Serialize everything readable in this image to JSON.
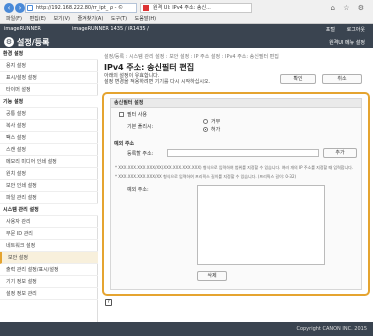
{
  "browser": {
    "address": "http://192.168.222.80/rr_ipt_ ρ - ©",
    "tab_title": "원격 UI: IPv4 주소: 송신...",
    "menu": [
      "파일(F)",
      "편집(E)",
      "보기(V)",
      "즐겨찾기(A)",
      "도구(T)",
      "도움말(H)"
    ]
  },
  "header": {
    "brand": "imageRUNNER",
    "model": "imageRUNNER 1435 / iR1435 /",
    "portal_link": "포털",
    "logout_link": "로그아웃",
    "section_title": "설정/등록",
    "user_info": "원격UI 메뉴 설정"
  },
  "sidebar": {
    "items": [
      {
        "label": "환경 설정",
        "type": "head"
      },
      {
        "label": "용지 설정",
        "type": "item"
      },
      {
        "label": "표시/설정 설정",
        "type": "item"
      },
      {
        "label": "타이머 설정",
        "type": "item"
      },
      {
        "label": "기능 설정",
        "type": "head"
      },
      {
        "label": "공통 설정",
        "type": "item"
      },
      {
        "label": "복사 설정",
        "type": "item"
      },
      {
        "label": "팩스 설정",
        "type": "item"
      },
      {
        "label": "스캔 설정",
        "type": "item"
      },
      {
        "label": "메모리 미디어 인쇄 설정",
        "type": "item"
      },
      {
        "label": "원치 설정",
        "type": "item"
      },
      {
        "label": "보안 인쇄 설정",
        "type": "item"
      },
      {
        "label": "파일 관리 설정",
        "type": "item"
      },
      {
        "label": "시스템 관리 설정",
        "type": "head"
      },
      {
        "label": "사용자 관리",
        "type": "item"
      },
      {
        "label": "부문 ID 관리",
        "type": "item"
      },
      {
        "label": "네트워크 설정",
        "type": "item"
      },
      {
        "label": "보안 설정",
        "type": "active"
      },
      {
        "label": "출력 관리 설정/표시/설정",
        "type": "item"
      },
      {
        "label": "기기 정보 설정",
        "type": "item"
      },
      {
        "label": "설정 정보 관리",
        "type": "item"
      }
    ]
  },
  "main": {
    "breadcrumb": "설정/등록 : 시스템 관리 설정 : 보안 설정 : IP 주소 설정 : IPv4 주소: 송신필터 편집",
    "title": "IPv4 주소: 송신필터 편집",
    "desc_line1": "아래의 설정이 유효합니다.",
    "desc_line2": "설정 변경을 적용하려면 기기를 다시 시작하십시오.",
    "ok_label": "확인",
    "cancel_label": "취소",
    "filter_section": "송신필터 설정",
    "use_filter_label": "필터 사용",
    "default_policy_label": "기본 폴리시:",
    "policy_options": [
      "거부",
      "허가"
    ],
    "policy_selected": "허가",
    "exception_section": "예외 주소",
    "address_label": "등록할 주소:",
    "add_label": "추가",
    "note1": "* XXX.XXX.XXX.XXX/XX(XXX.XXX.XXX.XXX) 형식으로 입력하여 범위를 지정할 수 있습니다. 여러 개의 IP 주소를 지정할 때 입력합니다.",
    "note2": "* XXX.XXX.XXX.XXX/XX 형식으로 입력하여 프리픽스 길이를 지정할 수 있습니다. (프리픽스 길이: 0-32)",
    "exception_list_label": "예외 주소:",
    "delete_label": "삭제"
  },
  "footer": {
    "copyright": "Copyright CANON INC. 2015"
  }
}
